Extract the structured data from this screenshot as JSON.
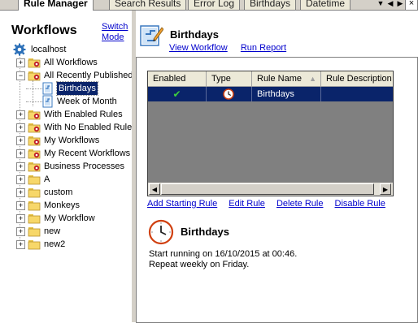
{
  "tabs": [
    {
      "label": "Rule Manager",
      "active": true
    },
    {
      "label": "Search Results",
      "active": false
    },
    {
      "label": "Error Log",
      "active": false
    },
    {
      "label": "Birthdays",
      "active": false
    },
    {
      "label": "Datetime",
      "active": false
    }
  ],
  "tab_controls": {
    "dropdown_icon": "chevron-down-icon",
    "prev_icon": "scroll-left-icon",
    "next_icon": "scroll-right-icon",
    "close_icon": "close-icon",
    "close_glyph": "×"
  },
  "left": {
    "title": "Workflows",
    "switch_mode_line1": "Switch",
    "switch_mode_line2": "Mode",
    "root": {
      "label": "localhost",
      "icon": "server-gear-icon"
    },
    "nodes": [
      {
        "label": "All Workflows",
        "icon": "folder-special-icon",
        "expander": "+"
      },
      {
        "label": "All Recently Published",
        "icon": "folder-special-icon",
        "expander": "-"
      },
      {
        "label": "Birthdays",
        "icon": "workflow-doc-icon",
        "selected": true
      },
      {
        "label": "Week of Month",
        "icon": "workflow-doc-icon"
      },
      {
        "label": "With Enabled Rules",
        "icon": "folder-special-icon",
        "expander": "+"
      },
      {
        "label": "With No Enabled Rules",
        "icon": "folder-special-icon",
        "expander": "+"
      },
      {
        "label": "My Workflows",
        "icon": "folder-special-icon",
        "expander": "+"
      },
      {
        "label": "My Recent Workflows",
        "icon": "folder-special-icon",
        "expander": "+"
      },
      {
        "label": "Business Processes",
        "icon": "folder-special-icon",
        "expander": "+"
      },
      {
        "label": "A",
        "icon": "folder-icon",
        "expander": "+"
      },
      {
        "label": "custom",
        "icon": "folder-icon",
        "expander": "+"
      },
      {
        "label": "Monkeys",
        "icon": "folder-icon",
        "expander": "+"
      },
      {
        "label": "My Workflow",
        "icon": "folder-icon",
        "expander": "+"
      },
      {
        "label": "new",
        "icon": "folder-icon",
        "expander": "+"
      },
      {
        "label": "new2",
        "icon": "folder-icon",
        "expander": "+"
      }
    ]
  },
  "header": {
    "title": "Birthdays",
    "view_workflow": "View Workflow",
    "run_report": "Run Report"
  },
  "grid": {
    "columns": [
      "Enabled",
      "Type",
      "Rule Name",
      "Rule Description"
    ],
    "sort_icon": "sort-up-icon",
    "rows": [
      {
        "enabled": "✔",
        "type_icon": "clock-icon",
        "rule_name": "Birthdays",
        "rule_description": ""
      }
    ]
  },
  "actions": {
    "add_starting_rule": "Add Starting Rule",
    "edit_rule": "Edit Rule",
    "delete_rule": "Delete Rule",
    "disable_rule": "Disable Rule"
  },
  "schedule": {
    "title": "Birthdays",
    "line1": "Start running on 16/10/2015 at 00:46.",
    "line2": "Repeat weekly on Friday."
  },
  "colors": {
    "selection": "#0a246a",
    "link": "#0000cc",
    "chrome": "#d4d0c8",
    "grid_empty": "#808080"
  }
}
